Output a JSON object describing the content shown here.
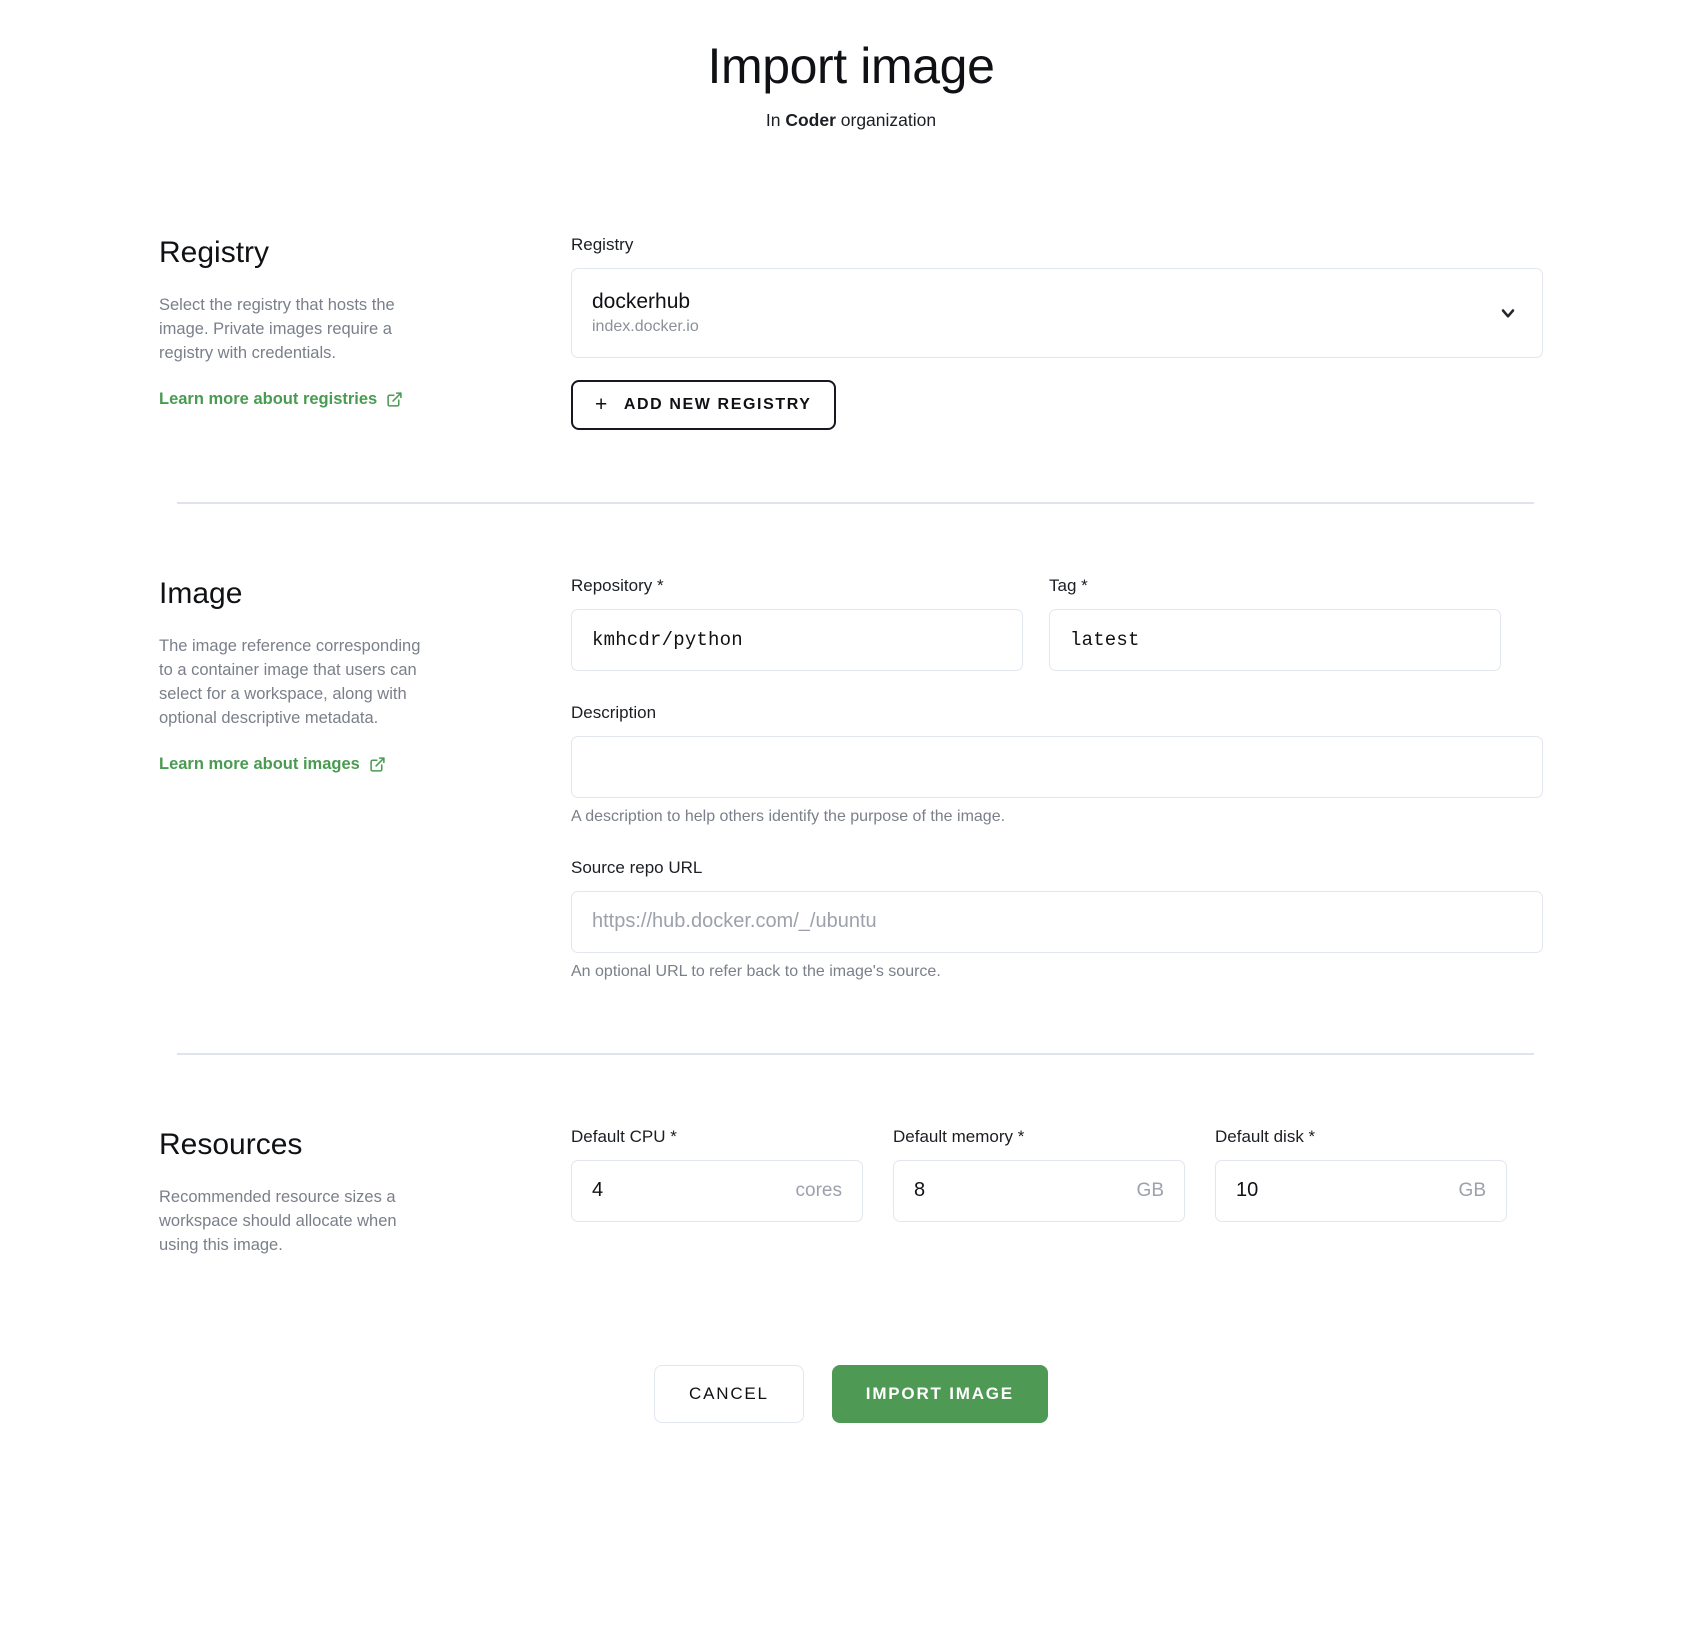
{
  "header": {
    "title": "Import image",
    "subtitle_prefix": "In ",
    "subtitle_org": "Coder",
    "subtitle_suffix": " organization"
  },
  "colors": {
    "accent_green": "#4e9a55",
    "link_green": "#4a9b52",
    "border": "#e2e6ef",
    "divider": "#dfe3ec",
    "muted_text": "#7a7f89"
  },
  "sections": {
    "registry": {
      "heading": "Registry",
      "description": "Select the registry that hosts the image. Private images require a registry with credentials.",
      "link_label": "Learn more about registries",
      "link_icon": "external-link-icon",
      "field_label": "Registry",
      "selected_primary": "dockerhub",
      "selected_secondary": "index.docker.io",
      "chevron_icon": "chevron-down-icon",
      "add_button_label": "ADD NEW REGISTRY",
      "add_button_icon": "plus-icon"
    },
    "image": {
      "heading": "Image",
      "description": "The image reference corresponding to a container image that users can select for a workspace, along with optional descriptive metadata.",
      "link_label": "Learn more about images",
      "link_icon": "external-link-icon",
      "repository": {
        "label": "Repository *",
        "value": "kmhcdr/python",
        "placeholder": ""
      },
      "tag": {
        "label": "Tag *",
        "value": "latest",
        "placeholder": ""
      },
      "description_field": {
        "label": "Description",
        "value": "",
        "placeholder": "",
        "helper": "A description to help others identify the purpose of the image."
      },
      "source_repo_url": {
        "label": "Source repo URL",
        "value": "",
        "placeholder": "https://hub.docker.com/_/ubuntu",
        "helper": "An optional URL to refer back to the image's source."
      }
    },
    "resources": {
      "heading": "Resources",
      "description": "Recommended resource sizes a workspace should allocate when using this image.",
      "fields": [
        {
          "label": "Default CPU *",
          "value": "4",
          "unit": "cores"
        },
        {
          "label": "Default memory *",
          "value": "8",
          "unit": "GB"
        },
        {
          "label": "Default disk *",
          "value": "10",
          "unit": "GB"
        }
      ]
    }
  },
  "footer": {
    "cancel_label": "CANCEL",
    "submit_label": "IMPORT IMAGE"
  }
}
